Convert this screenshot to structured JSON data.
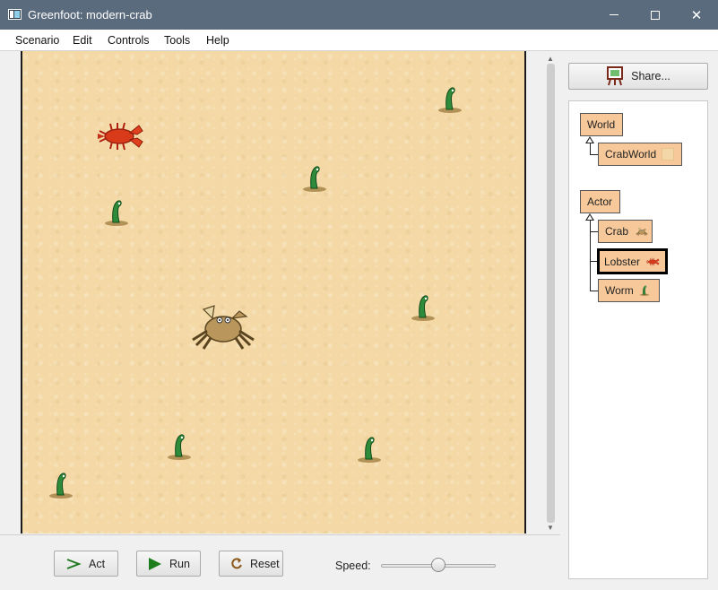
{
  "window": {
    "title": "Greenfoot: modern-crab",
    "icon": "greenfoot-app-icon"
  },
  "menu": {
    "items": [
      "Scenario",
      "Edit",
      "Controls",
      "Tools",
      "Help"
    ]
  },
  "world": {
    "background": "sand",
    "actors": [
      "lobster",
      "crab",
      "worm",
      "worm",
      "worm",
      "worm",
      "worm",
      "worm",
      "worm"
    ]
  },
  "controls": {
    "act_label": "Act",
    "run_label": "Run",
    "reset_label": "Reset",
    "speed_label": "Speed:",
    "speed_value": 0.5
  },
  "share": {
    "label": "Share...",
    "icon": "easel-icon"
  },
  "classes": {
    "world_root": "World",
    "world_sub": "CrabWorld",
    "actor_root": "Actor",
    "crab": "Crab",
    "lobster": "Lobster",
    "worm": "Worm",
    "selected": "Lobster"
  },
  "colors": {
    "class_box": "#f7c99a",
    "titlebar": "#5b6b7e",
    "sand": "#f4d9a6",
    "worm": "#2e8b3a",
    "lobster": "#d83a1a"
  }
}
